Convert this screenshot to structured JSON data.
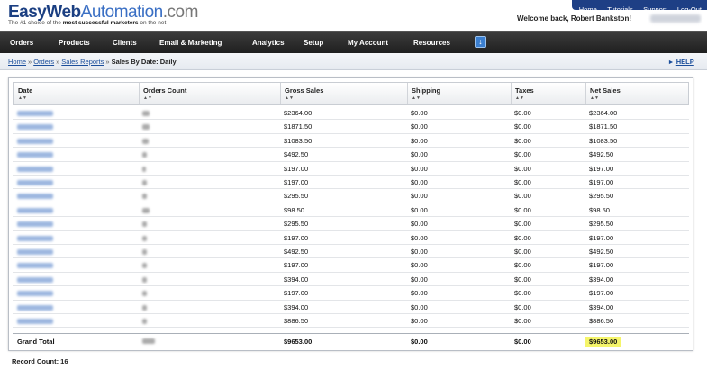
{
  "header": {
    "logo_parts": [
      "Easy",
      "Web",
      "Automation",
      ".com"
    ],
    "tagline_pre": "The #1 choice of the ",
    "tagline_bold": "most successful marketers",
    "tagline_post": " on the net",
    "welcome": "Welcome back, Robert Bankston!",
    "top_links": [
      "Home",
      "Tutorials",
      "Support",
      "Log-Out"
    ]
  },
  "nav": {
    "items": [
      "Orders",
      "Products",
      "Clients",
      "Email & Marketing",
      "Analytics",
      "Setup",
      "My Account",
      "Resources"
    ],
    "download_icon": "download-icon"
  },
  "breadcrumb": {
    "links": [
      "Home",
      "Orders",
      "Sales Reports"
    ],
    "separator": "»",
    "current": "Sales By Date: Daily"
  },
  "help": {
    "label": "HELP"
  },
  "table": {
    "columns": [
      "Date",
      "Orders Count",
      "Gross Sales",
      "Shipping",
      "Taxes",
      "Net Sales"
    ],
    "rows": [
      {
        "gross": "$2364.00",
        "shipping": "$0.00",
        "taxes": "$0.00",
        "net": "$2364.00"
      },
      {
        "gross": "$1871.50",
        "shipping": "$0.00",
        "taxes": "$0.00",
        "net": "$1871.50"
      },
      {
        "gross": "$1083.50",
        "shipping": "$0.00",
        "taxes": "$0.00",
        "net": "$1083.50"
      },
      {
        "gross": "$492.50",
        "shipping": "$0.00",
        "taxes": "$0.00",
        "net": "$492.50"
      },
      {
        "gross": "$197.00",
        "shipping": "$0.00",
        "taxes": "$0.00",
        "net": "$197.00"
      },
      {
        "gross": "$197.00",
        "shipping": "$0.00",
        "taxes": "$0.00",
        "net": "$197.00"
      },
      {
        "gross": "$295.50",
        "shipping": "$0.00",
        "taxes": "$0.00",
        "net": "$295.50"
      },
      {
        "gross": "$98.50",
        "shipping": "$0.00",
        "taxes": "$0.00",
        "net": "$98.50"
      },
      {
        "gross": "$295.50",
        "shipping": "$0.00",
        "taxes": "$0.00",
        "net": "$295.50"
      },
      {
        "gross": "$197.00",
        "shipping": "$0.00",
        "taxes": "$0.00",
        "net": "$197.00"
      },
      {
        "gross": "$492.50",
        "shipping": "$0.00",
        "taxes": "$0.00",
        "net": "$492.50"
      },
      {
        "gross": "$197.00",
        "shipping": "$0.00",
        "taxes": "$0.00",
        "net": "$197.00"
      },
      {
        "gross": "$394.00",
        "shipping": "$0.00",
        "taxes": "$0.00",
        "net": "$394.00"
      },
      {
        "gross": "$197.00",
        "shipping": "$0.00",
        "taxes": "$0.00",
        "net": "$197.00"
      },
      {
        "gross": "$394.00",
        "shipping": "$0.00",
        "taxes": "$0.00",
        "net": "$394.00"
      },
      {
        "gross": "$886.50",
        "shipping": "$0.00",
        "taxes": "$0.00",
        "net": "$886.50"
      }
    ],
    "total": {
      "label": "Grand Total",
      "gross": "$9653.00",
      "shipping": "$0.00",
      "taxes": "$0.00",
      "net": "$9653.00"
    }
  },
  "record_count": "Record Count: 16",
  "colors": {
    "nav_bg": "#2b2b2b",
    "top_links_bg": "#1e3f85",
    "link": "#1b4e9b",
    "highlight": "#f5f56a"
  }
}
